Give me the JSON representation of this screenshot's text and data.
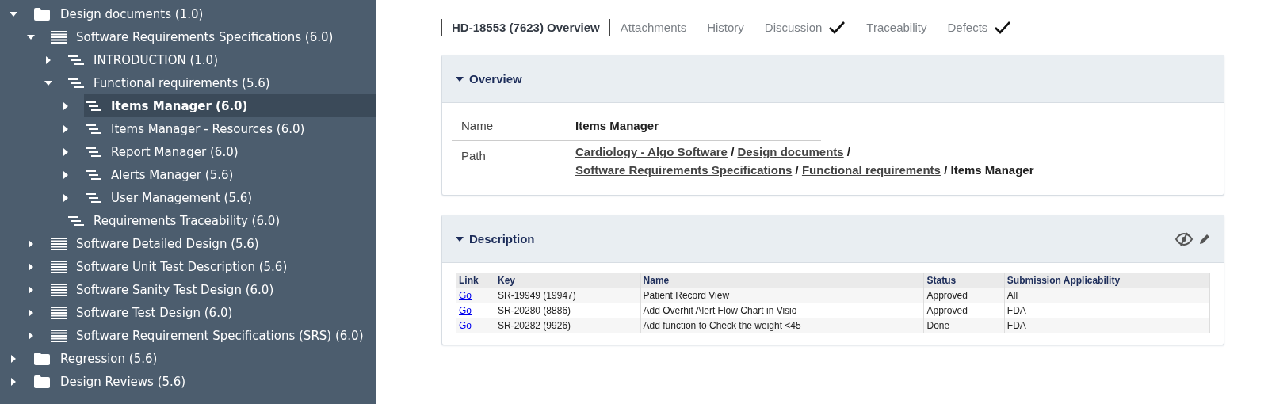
{
  "sidebar": {
    "tree": [
      {
        "label": "Design documents (1.0)",
        "kind": "folder",
        "expandable": true,
        "expanded": true,
        "selected": false,
        "children": [
          {
            "label": "Software Requirements Specifications (6.0)",
            "kind": "document",
            "expandable": true,
            "expanded": true,
            "selected": false,
            "children": [
              {
                "label": "INTRODUCTION (1.0)",
                "kind": "section",
                "expandable": true,
                "expanded": false,
                "selected": false
              },
              {
                "label": "Functional requirements (5.6)",
                "kind": "section",
                "expandable": true,
                "expanded": true,
                "selected": false,
                "children": [
                  {
                    "label": "Items Manager (6.0)",
                    "kind": "section",
                    "expandable": true,
                    "expanded": false,
                    "selected": true
                  },
                  {
                    "label": "Items Manager - Resources (6.0)",
                    "kind": "section",
                    "expandable": true,
                    "expanded": false,
                    "selected": false
                  },
                  {
                    "label": "Report Manager (6.0)",
                    "kind": "section",
                    "expandable": true,
                    "expanded": false,
                    "selected": false
                  },
                  {
                    "label": "Alerts Manager (5.6)",
                    "kind": "section",
                    "expandable": true,
                    "expanded": false,
                    "selected": false
                  },
                  {
                    "label": "User Management (5.6)",
                    "kind": "section",
                    "expandable": true,
                    "expanded": false,
                    "selected": false
                  }
                ]
              },
              {
                "label": "Requirements Traceability (6.0)",
                "kind": "section",
                "expandable": false,
                "selected": false
              }
            ]
          },
          {
            "label": "Software Detailed Design (5.6)",
            "kind": "document",
            "expandable": true,
            "expanded": false,
            "selected": false
          },
          {
            "label": "Software Unit Test Description (5.6)",
            "kind": "document",
            "expandable": true,
            "expanded": false,
            "selected": false
          },
          {
            "label": "Software Sanity Test Design (6.0)",
            "kind": "document",
            "expandable": true,
            "expanded": false,
            "selected": false
          },
          {
            "label": "Software Test Design (6.0)",
            "kind": "document",
            "expandable": true,
            "expanded": false,
            "selected": false
          },
          {
            "label": "Software Requirement Specifications (SRS) (6.0)",
            "kind": "document",
            "expandable": true,
            "expanded": false,
            "selected": false
          }
        ]
      },
      {
        "label": "Regression (5.6)",
        "kind": "folder",
        "expandable": true,
        "expanded": false,
        "selected": false
      },
      {
        "label": "Design Reviews (5.6)",
        "kind": "folder",
        "expandable": true,
        "expanded": false,
        "selected": false
      }
    ]
  },
  "tabs": [
    {
      "label": "HD-18553 (7623) Overview",
      "selected": true,
      "checked": false
    },
    {
      "label": "Attachments",
      "selected": false,
      "checked": false
    },
    {
      "label": "History",
      "selected": false,
      "checked": false
    },
    {
      "label": "Discussion",
      "selected": false,
      "checked": true
    },
    {
      "label": "Traceability",
      "selected": false,
      "checked": false
    },
    {
      "label": "Defects",
      "selected": false,
      "checked": true
    }
  ],
  "overview": {
    "title": "Overview",
    "expanded": true,
    "name_label": "Name",
    "name_value": "Items Manager",
    "path_label": "Path",
    "path": [
      {
        "text": "Cardiology - Algo Software",
        "kind": "link"
      },
      {
        "text": "/",
        "kind": "separator"
      },
      {
        "text": "Design documents",
        "kind": "link"
      },
      {
        "text": "/",
        "kind": "separator"
      },
      {
        "text": "Software Requirements Specifications",
        "kind": "link"
      },
      {
        "text": "/",
        "kind": "separator"
      },
      {
        "text": "Functional requirements",
        "kind": "link"
      },
      {
        "text": "/",
        "kind": "separator"
      },
      {
        "text": "Items Manager",
        "kind": "current"
      }
    ]
  },
  "description": {
    "title": "Description",
    "expanded": true,
    "table": {
      "columns": [
        "Link",
        "Key",
        "Name",
        "Status",
        "Submission Applicability"
      ],
      "rows": [
        [
          "Go",
          "SR-19949 (19947)",
          "Patient Record View",
          "Approved",
          "All"
        ],
        [
          "Go",
          "SR-20280 (8886)",
          "Add Overhit Alert Flow Chart in Visio",
          "Approved",
          "FDA"
        ],
        [
          "Go",
          "SR-20282 (9926)",
          "Add function to Check the weight <45",
          "Done",
          "FDA"
        ]
      ]
    }
  }
}
